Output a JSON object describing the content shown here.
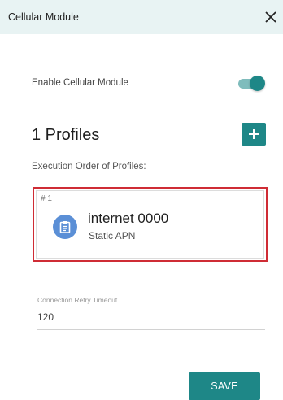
{
  "dialog": {
    "title": "Cellular Module"
  },
  "enable": {
    "label": "Enable Cellular Module",
    "checked": true
  },
  "profiles": {
    "title": "1 Profiles",
    "order_label": "Execution Order of Profiles:",
    "items": [
      {
        "number": "# 1",
        "name": "internet 0000",
        "type": "Static APN",
        "icon": "clipboard-icon"
      }
    ]
  },
  "retry": {
    "label": "Connection Retry Timeout",
    "value": "120"
  },
  "actions": {
    "save_label": "SAVE"
  },
  "colors": {
    "header_bg": "#e8f3f3",
    "accent": "#1e8787",
    "highlight_border": "#cf2c35",
    "avatar": "#5b8fd6"
  }
}
